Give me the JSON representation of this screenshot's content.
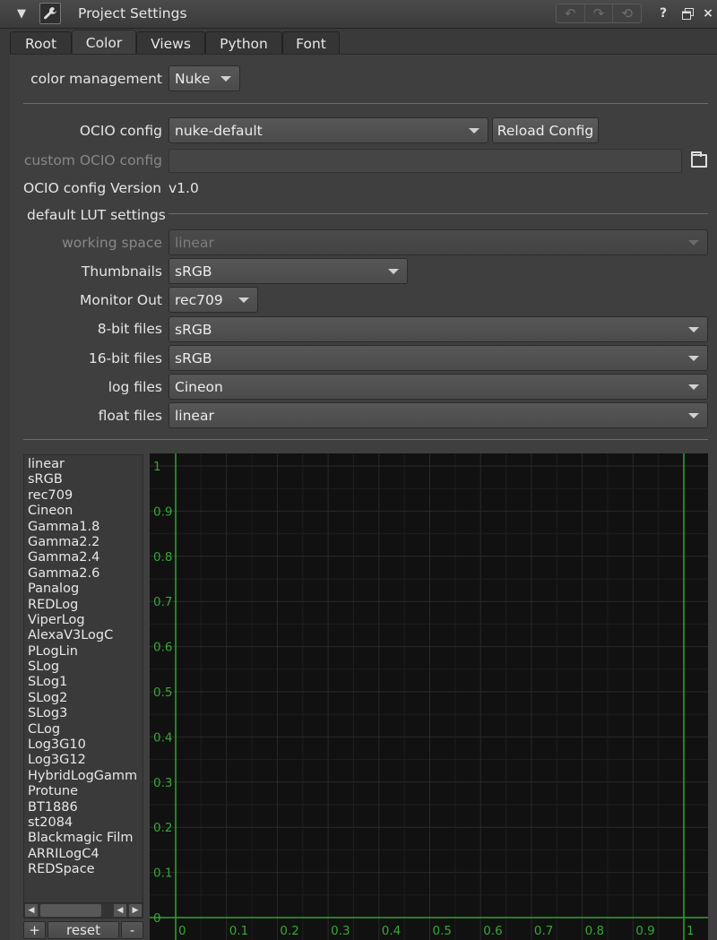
{
  "window": {
    "title": "Project Settings",
    "icons": {
      "collapse": "collapse-triangle-icon",
      "wrench": "wrench-icon",
      "undo": "undo-icon",
      "redo": "redo-icon",
      "revert": "revert-icon",
      "float": "float-window-icon",
      "close": "close-icon"
    },
    "help_label": "?",
    "close_label": "×"
  },
  "tabs": [
    {
      "label": "Root",
      "active": false
    },
    {
      "label": "Color",
      "active": true
    },
    {
      "label": "Views",
      "active": false
    },
    {
      "label": "Python",
      "active": false
    },
    {
      "label": "Font",
      "active": false
    }
  ],
  "color": {
    "color_management": {
      "label": "color management",
      "value": "Nuke"
    },
    "ocio_config": {
      "label": "OCIO config",
      "value": "nuke-default"
    },
    "reload_config_label": "Reload Config",
    "custom_ocio_config": {
      "label": "custom OCIO config",
      "value": ""
    },
    "ocio_version": {
      "label": "OCIO config Version",
      "value": "v1.0"
    },
    "lut_section_label": "default LUT settings",
    "working_space": {
      "label": "working space",
      "value": "linear"
    },
    "thumbnails": {
      "label": "Thumbnails",
      "value": "sRGB"
    },
    "monitor_out": {
      "label": "Monitor Out",
      "value": "rec709"
    },
    "eight_bit": {
      "label": "8-bit files",
      "value": "sRGB"
    },
    "sixteen_bit": {
      "label": "16-bit files",
      "value": "sRGB"
    },
    "log_files": {
      "label": "log files",
      "value": "Cineon"
    },
    "float_files": {
      "label": "float files",
      "value": "linear"
    }
  },
  "curve_list": [
    "linear",
    "sRGB",
    "rec709",
    "Cineon",
    "Gamma1.8",
    "Gamma2.2",
    "Gamma2.4",
    "Gamma2.6",
    "Panalog",
    "REDLog",
    "ViperLog",
    "AlexaV3LogC",
    "PLogLin",
    "SLog",
    "SLog1",
    "SLog2",
    "SLog3",
    "CLog",
    "Log3G10",
    "Log3G12",
    "HybridLogGamm",
    "Protune",
    "BT1886",
    "st2084",
    "Blackmagic Film",
    "ARRILogC4",
    "REDSpace"
  ],
  "curve_buttons": {
    "add_label": "+",
    "reset_label": "reset",
    "remove_label": "-"
  },
  "graph": {
    "grid_color": "#2a2a2a",
    "axis_color": "#2fa62f",
    "y_ticks": [
      "1",
      "0.9",
      "0.8",
      "0.7",
      "0.6",
      "0.5",
      "0.4",
      "0.3",
      "0.2",
      "0.1",
      "0"
    ],
    "x_ticks": [
      "0",
      "0.1",
      "0.2",
      "0.3",
      "0.4",
      "0.5",
      "0.6",
      "0.7",
      "0.8",
      "0.9",
      "1"
    ]
  }
}
